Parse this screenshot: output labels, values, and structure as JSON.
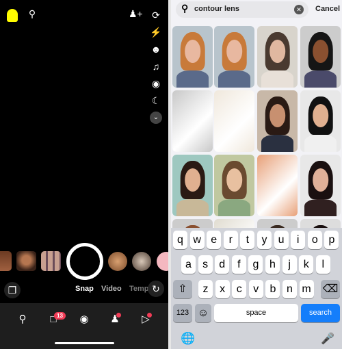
{
  "camera": {
    "modes": [
      "Snap",
      "Video",
      "Temp"
    ],
    "chat_badge": "13",
    "icons": [
      "ghost-icon",
      "search-icon",
      "add-friend-icon",
      "flip-camera-icon",
      "flash-off-icon",
      "lens-add-icon",
      "music-icon",
      "camera-timer-icon",
      "night-mode-icon",
      "chevron-down-icon"
    ],
    "nav": [
      "map-icon",
      "chat-icon",
      "camera-icon",
      "friends-icon",
      "stories-icon"
    ]
  },
  "search": {
    "query": "contour lens",
    "cancel_label": "Cancel"
  },
  "keyboard": {
    "row1": [
      "q",
      "w",
      "e",
      "r",
      "t",
      "y",
      "u",
      "i",
      "o",
      "p"
    ],
    "row2": [
      "a",
      "s",
      "d",
      "f",
      "g",
      "h",
      "j",
      "k",
      "l"
    ],
    "row3": [
      "z",
      "x",
      "c",
      "v",
      "b",
      "n",
      "m"
    ],
    "numbers_label": "123",
    "space_label": "space",
    "search_label": "search"
  },
  "colors": {
    "accent": "#147efb",
    "badge": "#f23c57",
    "ghost": "#fffc00"
  }
}
